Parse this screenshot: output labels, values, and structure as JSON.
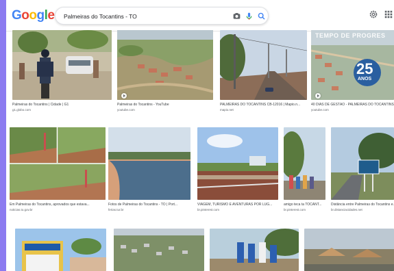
{
  "brand": {
    "logo_letters": [
      "G",
      "o",
      "o",
      "g",
      "l",
      "e"
    ]
  },
  "search": {
    "query": "Palmeiras do Tocantins - TO"
  },
  "header_icons": [
    "camera-icon",
    "microphone-icon",
    "search-icon",
    "settings-icon",
    "apps-icon"
  ],
  "results": [
    {
      "caption": "Palmeiras do Tocantins | Cidade | G1",
      "source": "g1.globo.com"
    },
    {
      "caption": "Palmeiras do Tocantins - YouTube",
      "source": "youtube.com"
    },
    {
      "caption": "PALMEIRAS DO TOCANTINS CB-12016 | Mapio.n...",
      "source": "mapio.net"
    },
    {
      "caption": "40 DIAS DE GESTÃO - PALMEIRAS DO TOCANTINS",
      "source": "youtube.com"
    },
    {
      "caption": "Em Palmeiras do Tocantins, aprovados que estava...",
      "source": "noticias.to.gov.br"
    },
    {
      "caption": "Fotos de Palmeiras do Tocantins - TO | Port...",
      "source": "ferias.tur.br"
    },
    {
      "caption": "VIAGEM, TURISMO E AVENTURAS POR LUG...",
      "source": "br.pinterest.com"
    },
    {
      "caption": "amigo teca ta TOCANT...",
      "source": "br.pinterest.com"
    },
    {
      "caption": "Distância entre Palmeiras do Tocantins e...",
      "source": "br.distanciacidades.net"
    }
  ],
  "overlays": {
    "tempo": "TEMPO DE PROGRES",
    "anos_num": "25",
    "anos_word": "ANOS"
  }
}
